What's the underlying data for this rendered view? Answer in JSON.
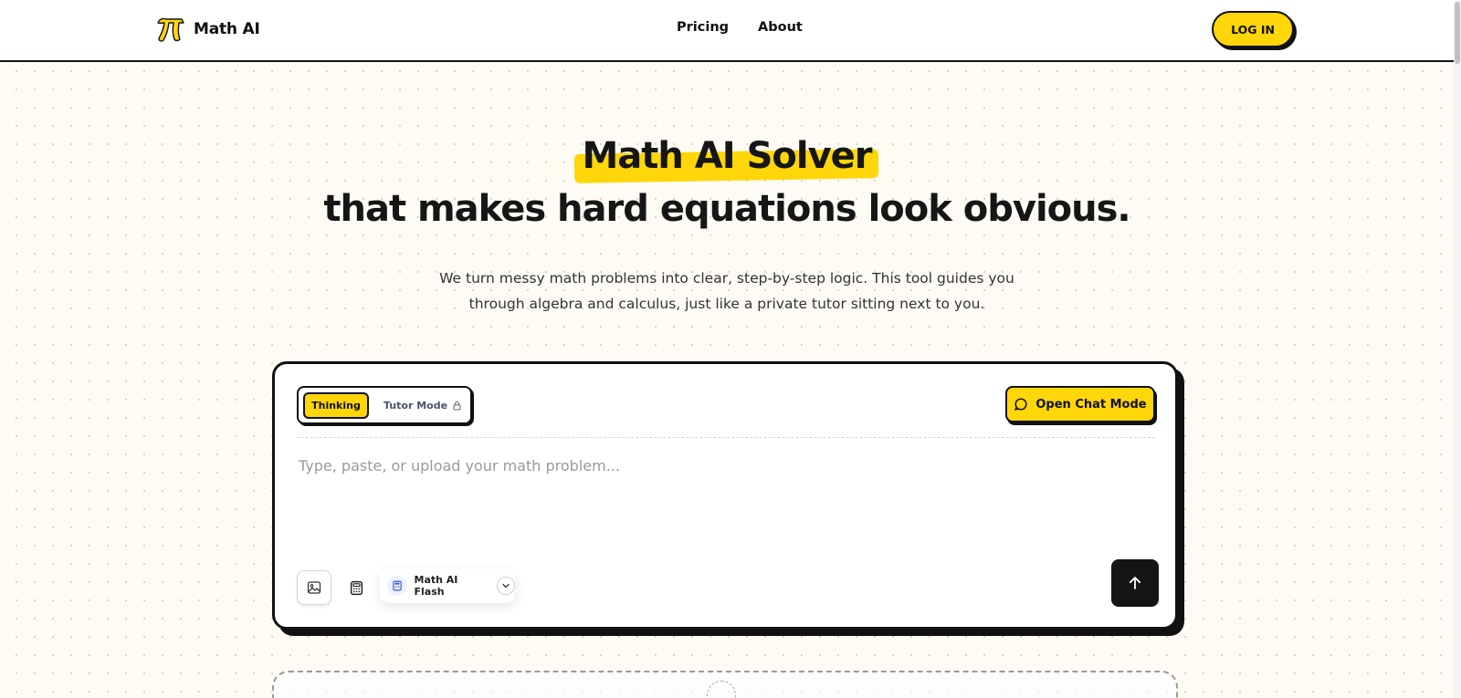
{
  "header": {
    "logo_text": "Math AI",
    "nav": [
      {
        "label": "Pricing"
      },
      {
        "label": "About"
      }
    ],
    "login_label": "LOG IN"
  },
  "hero": {
    "title_highlight": "Math AI Solver",
    "title_rest": "that makes hard equations look obvious.",
    "subtitle_line1": "We turn messy math problems into clear, step-by-step logic. This tool guides you",
    "subtitle_line2": "through algebra and calculus, just like a private tutor sitting next to you."
  },
  "solver": {
    "modes": {
      "thinking_label": "Thinking",
      "tutor_label": "Tutor Mode",
      "selected": "Thinking"
    },
    "chat_button_label": "Open Chat Mode",
    "input": {
      "placeholder": "Type, paste, or upload your math problem...",
      "value": ""
    },
    "model": {
      "selected": "Math AI Flash"
    }
  },
  "colors": {
    "accent": "#ffd60a",
    "ink": "#111111",
    "background": "#fdfbf4"
  },
  "icons": {
    "logo": "pi-icon",
    "tutor_lock": "lock-icon",
    "chat": "chat-bubble-icon",
    "upload": "image-icon",
    "calculator": "calculator-icon",
    "model": "calculator-icon",
    "model_dropdown": "chevron-down-icon",
    "submit": "arrow-up-icon"
  }
}
